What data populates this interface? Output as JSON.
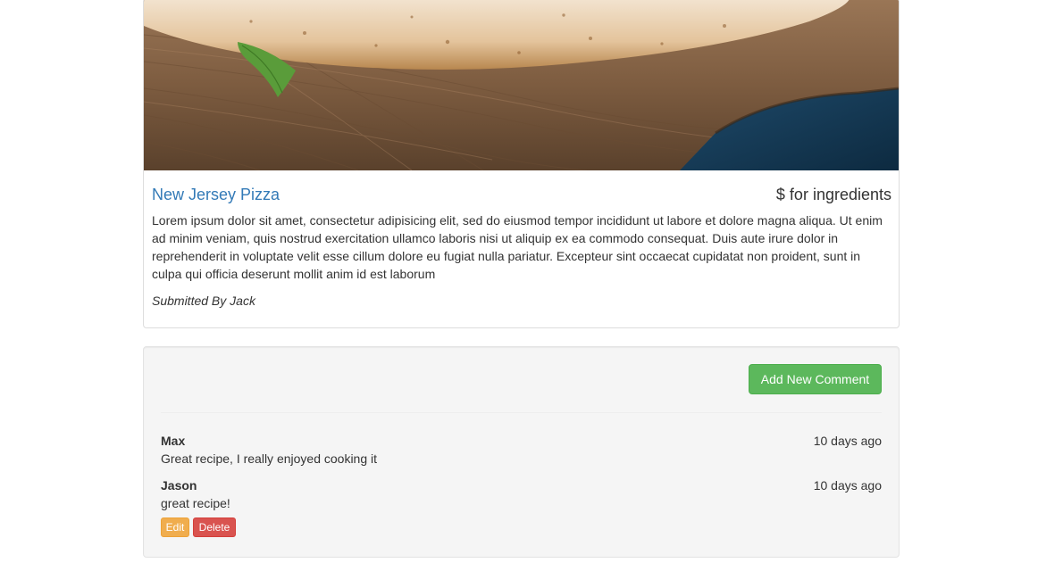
{
  "recipe": {
    "image_alt": "New Jersey Pizza",
    "title": "New Jersey Pizza",
    "price": "$ for ingredients",
    "description": "Lorem ipsum dolor sit amet, consectetur adipisicing elit, sed do eiusmod tempor incididunt ut labore et dolore magna aliqua. Ut enim ad minim veniam, quis nostrud exercitation ullamco laboris nisi ut aliquip ex ea commodo consequat. Duis aute irure dolor in reprehenderit in voluptate velit esse cillum dolore eu fugiat nulla pariatur. Excepteur sint occaecat cupidatat non proident, sunt in culpa qui officia deserunt mollit anim id est laborum",
    "submitted_by": "Submitted By Jack"
  },
  "comments_section": {
    "add_button_label": "Add New Comment",
    "comments": [
      {
        "author": "Max",
        "time": "10 days ago",
        "text": "Great recipe, I really enjoyed cooking it"
      },
      {
        "author": "Jason",
        "time": "10 days ago",
        "text": "great recipe!",
        "edit_label": "Edit",
        "delete_label": "Delete"
      }
    ]
  },
  "colors": {
    "link": "#337ab7",
    "success": "#5cb85c",
    "warning": "#f0ad4e",
    "danger": "#d9534f",
    "well_bg": "#f5f5f5"
  }
}
